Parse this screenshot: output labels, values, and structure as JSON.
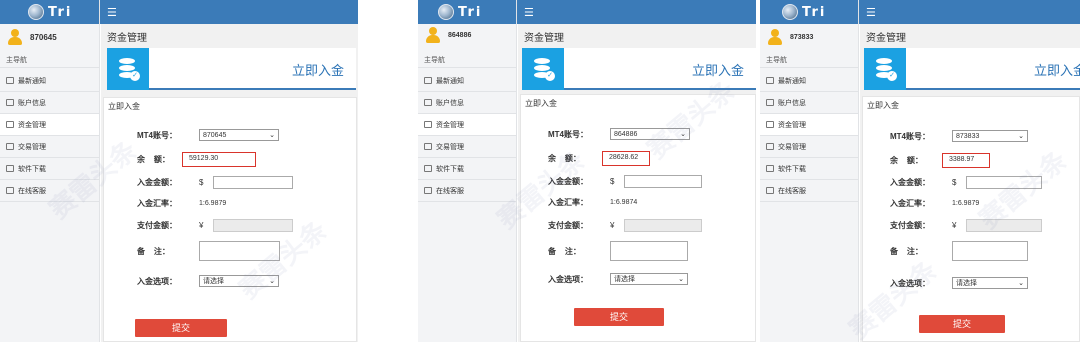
{
  "logo_text": "Tri",
  "menu_icon": "menu-icon",
  "nav_header": "主导航",
  "nav_items": [
    {
      "label": "最新通知",
      "icon": "notice-icon"
    },
    {
      "label": "账户信息",
      "icon": "account-icon"
    },
    {
      "label": "资金管理",
      "icon": "funds-icon"
    },
    {
      "label": "交易管理",
      "icon": "trade-icon"
    },
    {
      "label": "软件下载",
      "icon": "download-icon"
    },
    {
      "label": "在线客服",
      "icon": "support-icon"
    }
  ],
  "page_title": "资金管理",
  "banner_title": "立即入金",
  "card_title": "立即入金",
  "labels": {
    "account": "MT4账号：",
    "balance_1": "余",
    "balance_2": "额：",
    "amount": "入金金额：",
    "rate": "入金汇率：",
    "pay": "支付金额：",
    "remark_1": "备",
    "remark_2": "注：",
    "option": "入金选项："
  },
  "currency_usd": "$",
  "currency_cny": "¥",
  "select_placeholder": "请选择",
  "submit_label": "提交",
  "watermark": "赛雷头条",
  "panels": [
    {
      "account": "870645",
      "balance": "59129.30",
      "rate": "1:6.9879"
    },
    {
      "account": "864886",
      "balance": "28628.62",
      "rate": "1:6.9874"
    },
    {
      "account": "873833",
      "balance": "3388.97",
      "rate": "1:6.9879"
    }
  ],
  "colors": {
    "header_blue": "#3b7bb8",
    "highlight_red": "#d9342b",
    "submit_red": "#e04a3a",
    "banner_icon_blue": "#1ba1e2",
    "banner_icon_green": "#1eaa43"
  }
}
